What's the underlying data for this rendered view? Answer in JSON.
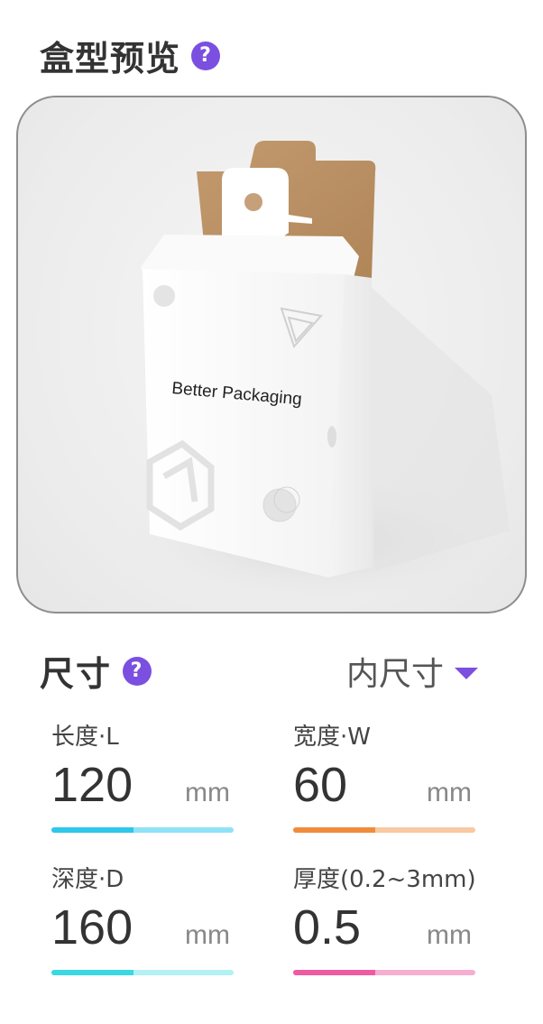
{
  "preview": {
    "title": "盒型预览",
    "help_glyph": "?",
    "box_print_text": "Better Packaging"
  },
  "size": {
    "title": "尺寸",
    "help_glyph": "?",
    "mode": "内尺寸"
  },
  "dimensions": {
    "length": {
      "label": "长度·L",
      "value": "120",
      "unit": "mm",
      "color": "#2ec7ea",
      "light_color": "#8fe2f6",
      "fill_fraction": 0.45
    },
    "width": {
      "label": "宽度·W",
      "value": "60",
      "unit": "mm",
      "color": "#f08c3c",
      "light_color": "#f9c9a2",
      "fill_fraction": 0.45
    },
    "depth": {
      "label": "深度·D",
      "value": "160",
      "unit": "mm",
      "color": "#3ad8e2",
      "light_color": "#b2f1f4",
      "fill_fraction": 0.45
    },
    "thickness": {
      "label": "厚度(0.2~3mm)",
      "value": "0.5",
      "unit": "mm",
      "color": "#ef5aa2",
      "light_color": "#f7aed1",
      "fill_fraction": 0.45
    }
  },
  "colors": {
    "accent": "#7b4fe0"
  }
}
